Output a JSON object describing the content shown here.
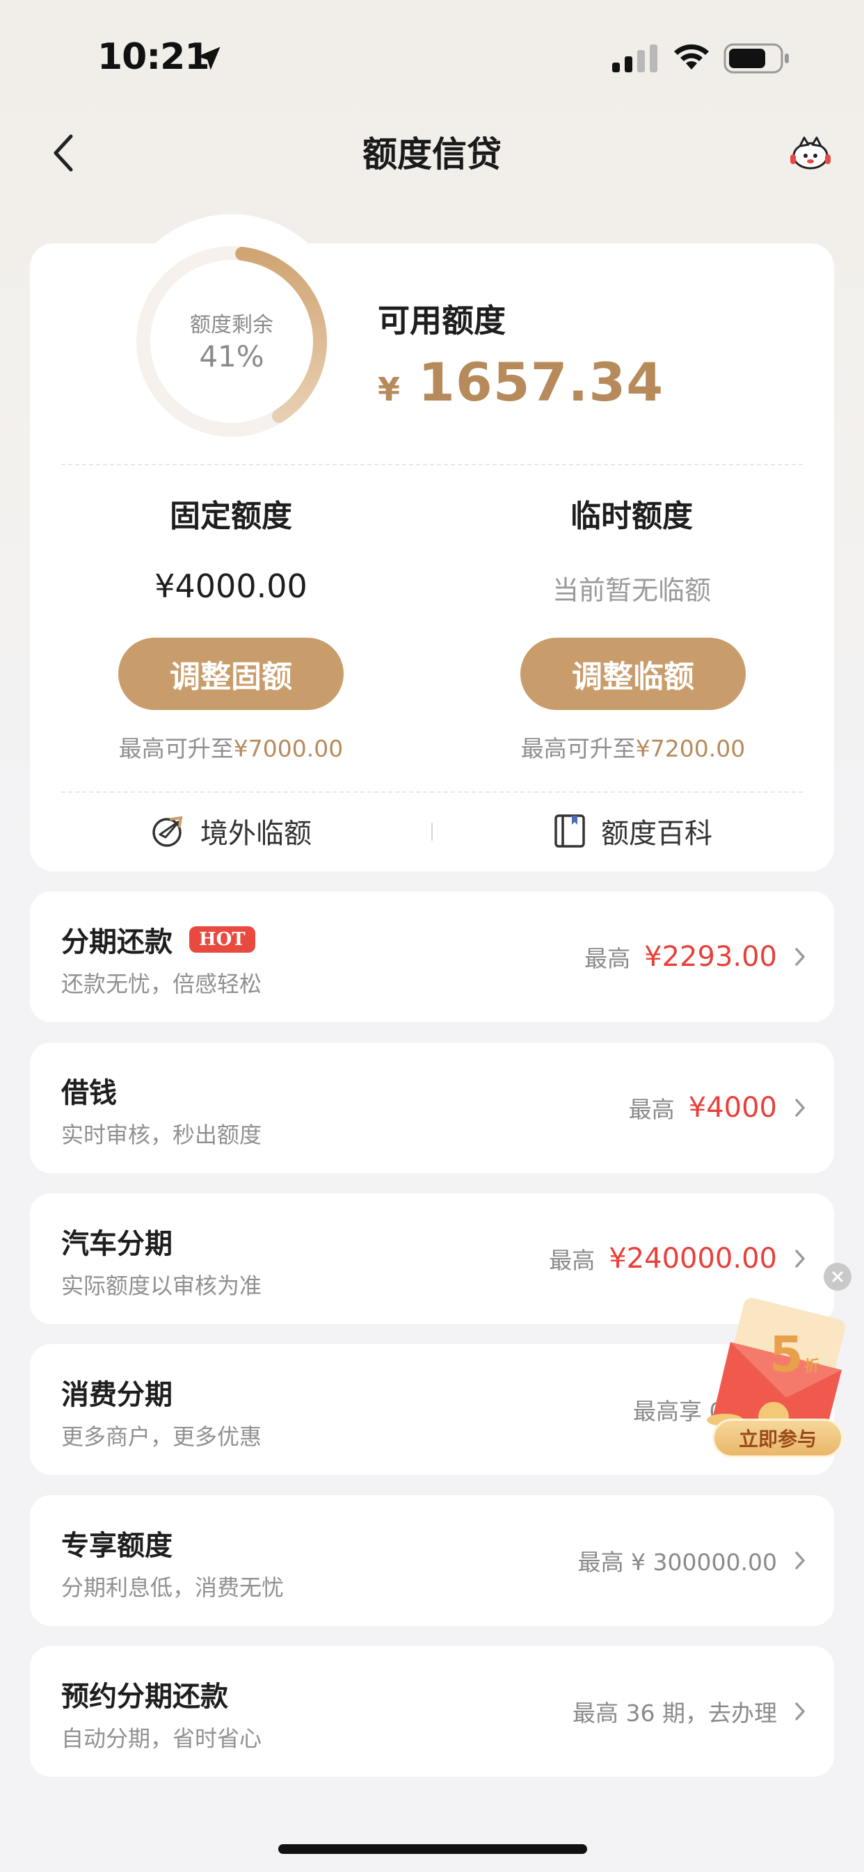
{
  "status_bar": {
    "time": "10:21"
  },
  "nav": {
    "title": "额度信贷"
  },
  "credit": {
    "ring_label": "额度剩余",
    "ring_percent": "41%",
    "remaining_fraction": 0.41,
    "available_label": "可用额度",
    "currency": "¥",
    "available_amount": "1657.34",
    "fixed": {
      "title": "固定额度",
      "value": "¥4000.00",
      "button": "调整固额",
      "max_prefix": "最高可升至",
      "max_value": "¥7000.00"
    },
    "temporary": {
      "title": "临时额度",
      "value": "当前暂无临额",
      "button": "调整临额",
      "max_prefix": "最高可升至",
      "max_value": "¥7200.00"
    },
    "links": {
      "overseas": "境外临额",
      "wiki": "额度百科"
    }
  },
  "list": [
    {
      "title": "分期还款",
      "badge": "HOT",
      "subtitle": "还款无忧，倍感轻松",
      "prefix": "最高",
      "amount": "¥2293.00"
    },
    {
      "title": "借钱",
      "subtitle": "实时审核，秒出额度",
      "prefix": "最高",
      "amount": "¥4000"
    },
    {
      "title": "汽车分期",
      "subtitle": "实际额度以审核为准",
      "prefix": "最高",
      "amount": "¥240000.00"
    },
    {
      "title": "消费分期",
      "subtitle": "更多商户，更多优惠",
      "text": "最高享 0 分期"
    },
    {
      "title": "专享额度",
      "subtitle": "分期利息低，消费无忧",
      "text": "最高 ¥ 300000.00"
    },
    {
      "title": "预约分期还款",
      "subtitle": "自动分期，省时省心",
      "text": "最高 36 期，去办理"
    }
  ],
  "promo": {
    "discount": "5",
    "discount_unit": "折",
    "button": "立即参与"
  },
  "colors": {
    "gold": "#c99c6c",
    "gold_text": "#b78a5b",
    "red": "#e8403a"
  }
}
